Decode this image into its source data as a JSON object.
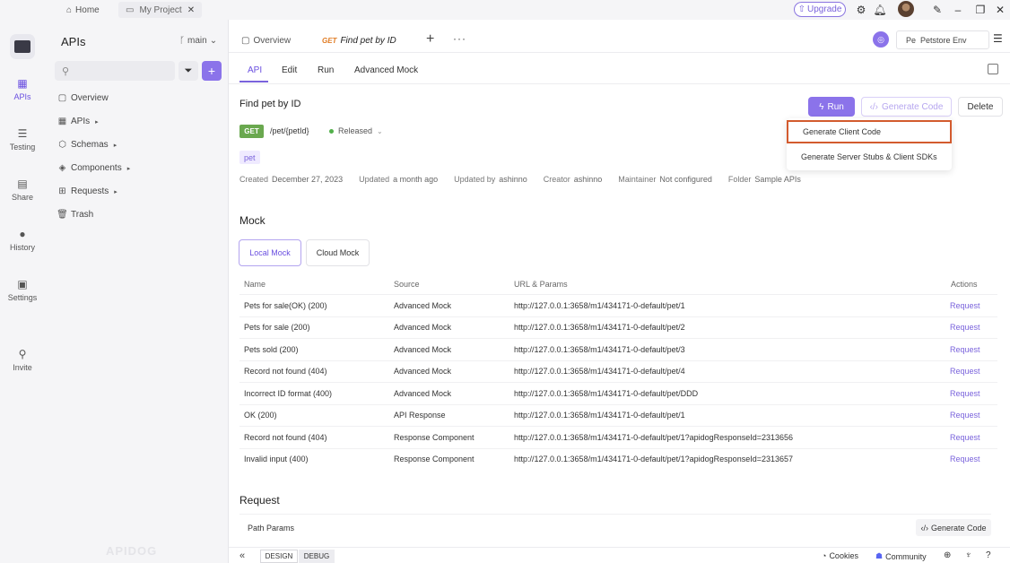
{
  "topbar": {
    "home_label": "Home",
    "project_label": "My Project",
    "upgrade_label": "Upgrade",
    "icons": [
      "settings-icon",
      "bell-icon",
      "avatar",
      "pin-icon",
      "minimize-icon",
      "restore-icon",
      "close-icon"
    ]
  },
  "rail": {
    "items": [
      {
        "label": "APIs",
        "icon": "apis-icon"
      },
      {
        "label": "Testing",
        "icon": "testing-icon"
      },
      {
        "label": "Share",
        "icon": "share-icon"
      },
      {
        "label": "History",
        "icon": "history-icon"
      },
      {
        "label": "Settings",
        "icon": "settings-icon"
      },
      {
        "label": "Invite",
        "icon": "invite-icon"
      }
    ]
  },
  "sidebar": {
    "title": "APIs",
    "branch": "main",
    "search_placeholder": "",
    "nav": [
      {
        "label": "Overview"
      },
      {
        "label": "APIs"
      },
      {
        "label": "Schemas"
      },
      {
        "label": "Components"
      },
      {
        "label": "Requests"
      },
      {
        "label": "Trash"
      }
    ],
    "watermark": "APIDOG"
  },
  "tabs": {
    "overview": "Overview",
    "active_method": "GET",
    "active_title": "Find pet by ID",
    "env": "Petstore Env"
  },
  "subtabs": [
    "API",
    "Edit",
    "Run",
    "Advanced Mock"
  ],
  "endpoint": {
    "title": "Find pet by ID",
    "run_label": "Run",
    "generate_label": "Generate Code",
    "delete_label": "Delete",
    "method": "GET",
    "path": "/pet/{petId}",
    "status": "Released",
    "tag": "pet",
    "meta": [
      {
        "key": "Created",
        "value": "December 27, 2023"
      },
      {
        "key": "Updated",
        "value": "a month ago"
      },
      {
        "key": "Updated by",
        "value": "ashinno"
      },
      {
        "key": "Creator",
        "value": "ashinno"
      },
      {
        "key": "Maintainer",
        "value": "Not configured"
      },
      {
        "key": "Folder",
        "value": "Sample APIs"
      }
    ]
  },
  "dropdown": {
    "items": [
      "Generate Client Code",
      "Generate Server Stubs & Client SDKs"
    ]
  },
  "mock": {
    "heading": "Mock",
    "tabs": [
      "Local Mock",
      "Cloud Mock"
    ],
    "columns": [
      "Name",
      "Source",
      "URL & Params",
      "Actions"
    ],
    "rows": [
      {
        "name": "Pets for sale(OK) (200)",
        "source": "Advanced Mock",
        "url": "http://127.0.0.1:3658/m1/434171-0-default/pet/1",
        "action": "Request"
      },
      {
        "name": "Pets for sale (200)",
        "source": "Advanced Mock",
        "url": "http://127.0.0.1:3658/m1/434171-0-default/pet/2",
        "action": "Request"
      },
      {
        "name": "Pets sold (200)",
        "source": "Advanced Mock",
        "url": "http://127.0.0.1:3658/m1/434171-0-default/pet/3",
        "action": "Request"
      },
      {
        "name": "Record not found (404)",
        "source": "Advanced Mock",
        "url": "http://127.0.0.1:3658/m1/434171-0-default/pet/4",
        "action": "Request"
      },
      {
        "name": "Incorrect ID format (400)",
        "source": "Advanced Mock",
        "url": "http://127.0.0.1:3658/m1/434171-0-default/pet/DDD",
        "action": "Request"
      },
      {
        "name": "OK (200)",
        "source": "API Response",
        "url": "http://127.0.0.1:3658/m1/434171-0-default/pet/1",
        "action": "Request"
      },
      {
        "name": "Record not found (404)",
        "source": "Response Component",
        "url": "http://127.0.0.1:3658/m1/434171-0-default/pet/1?apidogResponseId=2313656",
        "action": "Request"
      },
      {
        "name": "Invalid input (400)",
        "source": "Response Component",
        "url": "http://127.0.0.1:3658/m1/434171-0-default/pet/1?apidogResponseId=2313657",
        "action": "Request"
      }
    ]
  },
  "request": {
    "heading": "Request",
    "path_params": "Path Params",
    "generate_code": "Generate Code"
  },
  "bottombar": {
    "design": "DESIGN",
    "debug": "DEBUG",
    "cookies": "Cookies",
    "community": "Community"
  }
}
